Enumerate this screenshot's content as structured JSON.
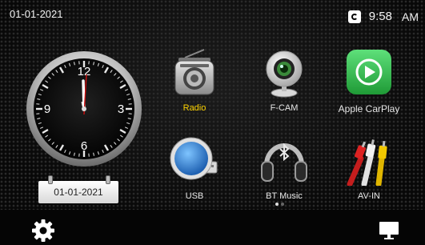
{
  "status_bar": {
    "date": "01-01-2021",
    "time": "9:58",
    "ampm": "AM",
    "carplay_status_icon": "carplay-connected-icon"
  },
  "clock_widget": {
    "numerals": [
      "12",
      "3",
      "6",
      "9"
    ],
    "date_label": "01-01-2021",
    "hour_hand_angle_deg": 0,
    "minute_hand_angle_deg": 180
  },
  "apps": [
    {
      "label": "Radio",
      "icon": "radio-icon",
      "active": true
    },
    {
      "label": "F-CAM",
      "icon": "webcam-icon",
      "active": false
    },
    {
      "label": "Apple CarPlay",
      "icon": "carplay-icon",
      "active": false
    },
    {
      "label": "USB",
      "icon": "usb-drive-icon",
      "active": false
    },
    {
      "label": "BT Music",
      "icon": "headphones-icon",
      "active": false
    },
    {
      "label": "AV-IN",
      "icon": "rca-cable-icon",
      "active": false
    }
  ],
  "pager": {
    "page_count": 2,
    "current_page": 1
  },
  "bottom_bar": {
    "left_icon": "gear-icon",
    "right_icon": "display-icon"
  },
  "colors": {
    "active_label": "#ffd400",
    "carplay_green": "#2fb84a",
    "usb_blue": "#2e86d6"
  }
}
